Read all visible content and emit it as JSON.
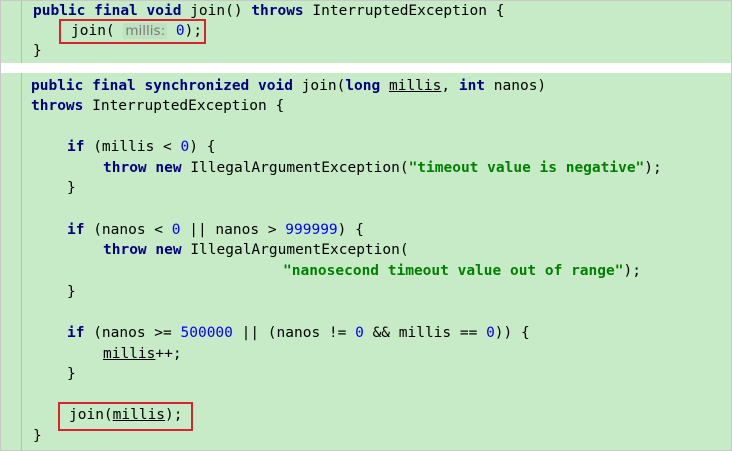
{
  "editor": {
    "method1": {
      "kw_public": "public",
      "kw_final": "final",
      "kw_void": "void",
      "signature_rest": " join() ",
      "kw_throws": "throws",
      "exception": " InterruptedException {",
      "call_prefix": "join(",
      "param_hint": "millis:",
      "arg_value": "0",
      "call_suffix": ");",
      "closing_brace": "}"
    },
    "method2": {
      "kw_public": "public",
      "kw_final": "final",
      "kw_synchronized": "synchronized",
      "kw_void": "void",
      "name": " join(",
      "kw_long": "long",
      "param_millis": "millis",
      "comma": ", ",
      "kw_int": "int",
      "param_nanos": " nanos)",
      "kw_throws": "throws",
      "exception": " InterruptedException {",
      "if1_kw": "if",
      "if1_cond_a": " (millis < ",
      "if1_zero": "0",
      "if1_cond_b": ") {",
      "throw_kw": "throw",
      "new_kw": "new",
      "iae": " IllegalArgumentException(",
      "msg1": "\"timeout value is negative\"",
      "stmt_end": ");",
      "close1": "}",
      "if2_kw": "if",
      "if2_a": " (nanos < ",
      "if2_zero": "0",
      "if2_b": " || nanos > ",
      "if2_max": "999999",
      "if2_c": ") {",
      "iae2": " IllegalArgumentException(",
      "msg2": "\"nanosecond timeout value out of range\"",
      "close2": "}",
      "if3_kw": "if",
      "if3_a": " (nanos >= ",
      "if3_half": "500000",
      "if3_b": " || (nanos != ",
      "if3_zero1": "0",
      "if3_c": " && millis == ",
      "if3_zero2": "0",
      "if3_d": ")) {",
      "increment_var": "millis",
      "increment_op": "++;",
      "close3": "}",
      "final_call_prefix": "join(",
      "final_call_arg": "millis",
      "final_call_suffix": ");",
      "closing_brace": "}"
    }
  },
  "colors": {
    "background_code": "#c7ebc7",
    "keyword": "#000080",
    "number": "#0000ff",
    "string": "#008000",
    "highlight_box": "#d9232e"
  }
}
